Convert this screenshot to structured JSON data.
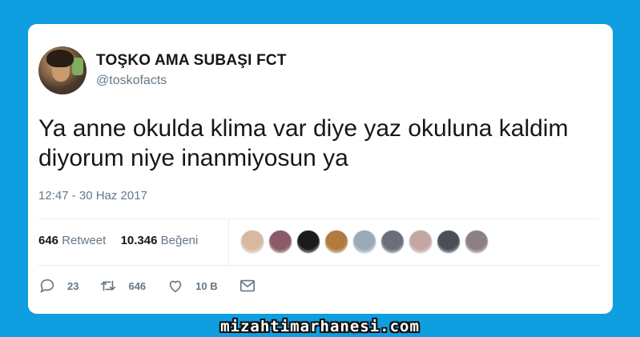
{
  "tweet": {
    "display_name": "TOŞKO AMA SUBAŞI FCT",
    "handle": "@toskofacts",
    "text": "Ya anne okulda klima var diye yaz okuluna kaldim diyorum niye inanmiyosun ya",
    "timestamp": "12:47 - 30 Haz 2017"
  },
  "stats": {
    "retweet_count": "646",
    "retweet_label": "Retweet",
    "like_count": "10.346",
    "like_label": "Beğeni"
  },
  "likers": [
    {
      "color": "#d9b8a0"
    },
    {
      "color": "#8a5a66"
    },
    {
      "color": "#1b1b1b"
    },
    {
      "color": "#b27a3c"
    },
    {
      "color": "#9aaab8"
    },
    {
      "color": "#6c6f7a"
    },
    {
      "color": "#c4a6a0"
    },
    {
      "color": "#4a4f55"
    },
    {
      "color": "#8d7f86"
    }
  ],
  "actions": {
    "reply_count": "23",
    "retweet_count": "646",
    "like_count": "10 B"
  },
  "footer": {
    "watermark": "mizahtimarhanesi.com"
  }
}
